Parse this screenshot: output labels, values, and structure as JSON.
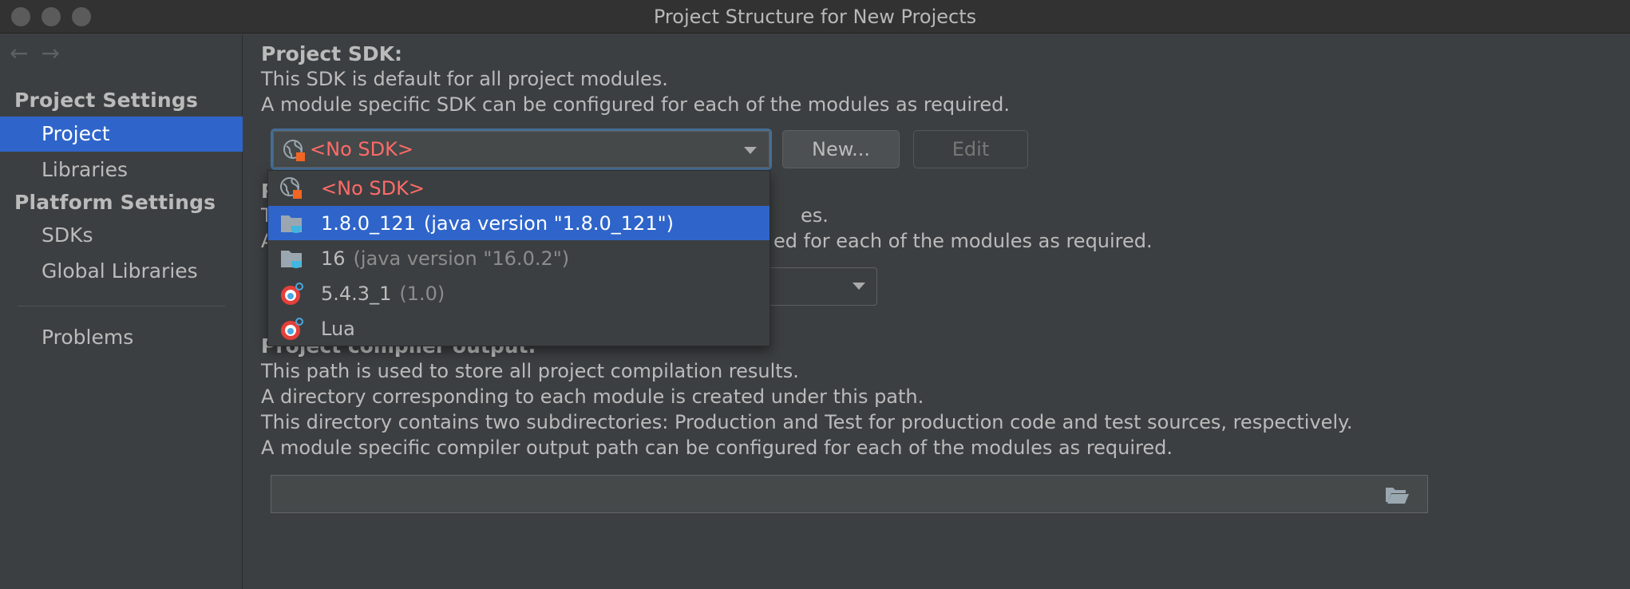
{
  "window": {
    "title": "Project Structure for New Projects"
  },
  "nav": {
    "back_icon": "←",
    "forward_icon": "→"
  },
  "sidebar": {
    "group1": "Project Settings",
    "group2": "Platform Settings",
    "items": [
      {
        "label": "Project",
        "selected": true
      },
      {
        "label": "Libraries"
      },
      {
        "label": "SDKs"
      },
      {
        "label": "Global Libraries"
      },
      {
        "label": "Problems"
      }
    ]
  },
  "project_sdk": {
    "heading": "Project SDK:",
    "desc1": "This SDK is default for all project modules.",
    "desc2": "A module specific SDK can be configured for each of the modules as required.",
    "selected_value": "<No SDK>",
    "new_button": "New...",
    "edit_button": "Edit"
  },
  "language_level": {
    "heading_partial": "P",
    "desc1_partial": "T",
    "desc1_tail": "es.",
    "desc2_partial": "A",
    "desc2_tail": "ed for each of the modules as required."
  },
  "compiler_output": {
    "heading": "Project compiler output:",
    "desc1": "This path is used to store all project compilation results.",
    "desc2": "A directory corresponding to each module is created under this path.",
    "desc3": "This directory contains two subdirectories: Production and Test for production code and test sources, respectively.",
    "desc4": "A module specific compiler output path can be configured for each of the modules as required.",
    "path_value": ""
  },
  "sdk_dropdown": {
    "items": [
      {
        "name": "<No SDK>",
        "detail": "",
        "icon": "globe-error-icon",
        "style": "red"
      },
      {
        "name": "1.8.0_121",
        "detail": "(java version \"1.8.0_121\")",
        "icon": "java-folder-icon",
        "selected": true
      },
      {
        "name": "16",
        "detail": "(java version \"16.0.2\")",
        "icon": "java-folder-icon"
      },
      {
        "name": "5.4.3_1",
        "detail": "(1.0)",
        "icon": "lua-sdk-icon"
      },
      {
        "name": "Lua",
        "detail": "",
        "icon": "lua-sdk-icon"
      }
    ]
  },
  "colors": {
    "accent": "#2f65ca",
    "error": "#ff6b68",
    "background": "#3c3f41"
  }
}
